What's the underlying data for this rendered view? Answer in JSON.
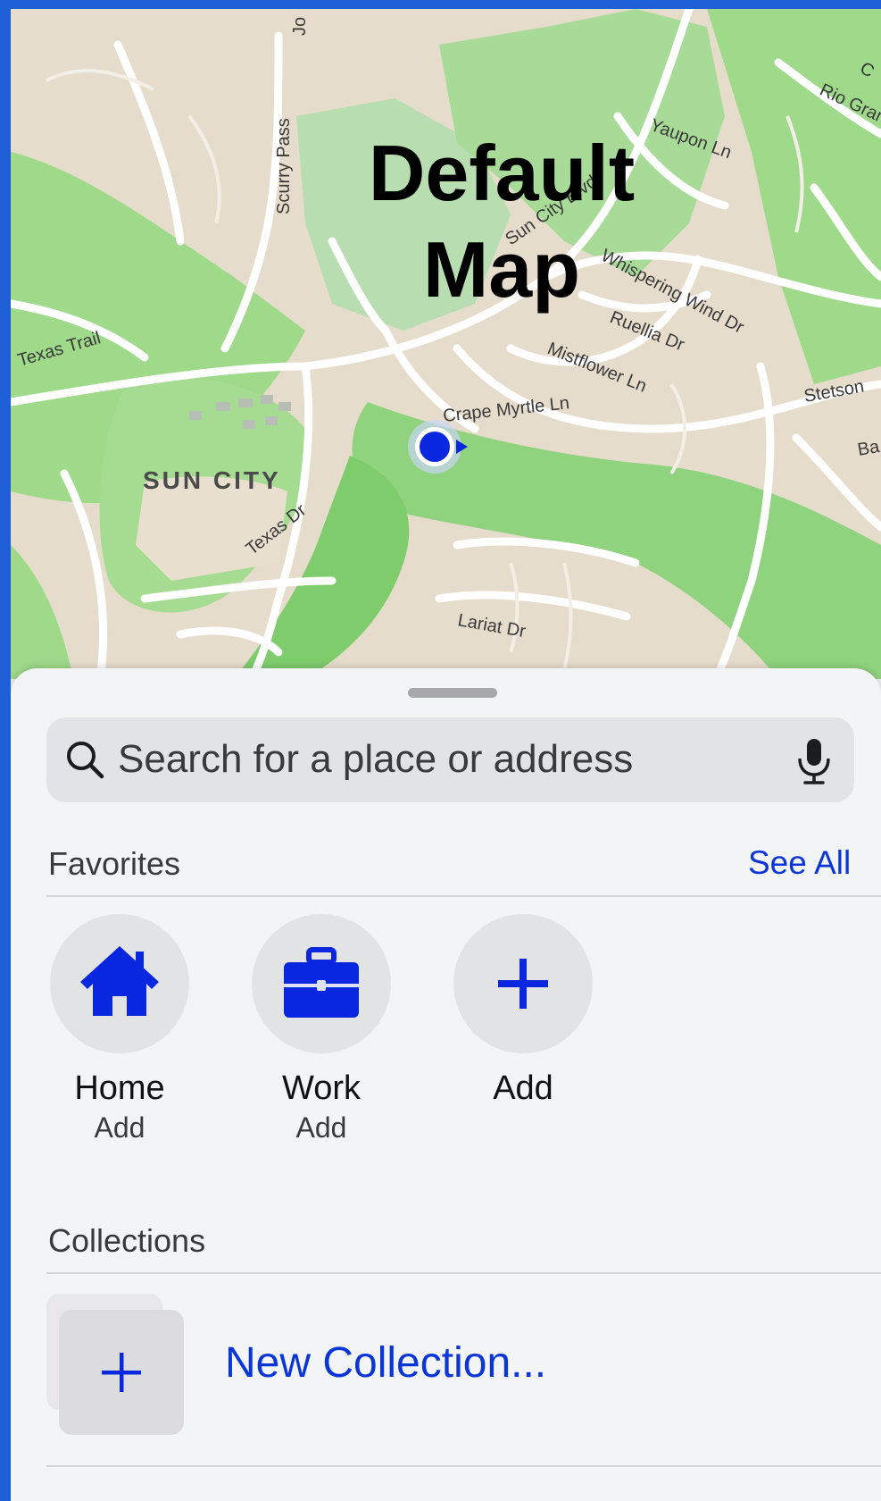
{
  "overlay": {
    "line1": "Default",
    "line2": "Map"
  },
  "map": {
    "labels": {
      "scurry_pass": "Scurry Pass",
      "yaupon_ln": "Yaupon Ln",
      "rio_grande": "Rio Gran",
      "sun_city_blvd": "Sun City Blvd",
      "whispering_wind": "Whispering Wind Dr",
      "ruellia": "Ruellia Dr",
      "mistflower": "Mistflower Ln",
      "texas_trail": "Texas Trail",
      "crepe_myrtle": "Crape Myrtle Ln",
      "stetson": "Stetson",
      "sun_city": "SUN CITY",
      "texas_dr": "Texas Dr",
      "lariat": "Lariat Dr",
      "ba": "Ba",
      "jo": "Jo",
      "co": "C"
    },
    "colors": {
      "land": "#e6dccb",
      "park": "#9fd98a",
      "park_dark": "#6cc460",
      "road": "#ffffff",
      "location": "#0a27e0"
    }
  },
  "search": {
    "placeholder": "Search for a place or address",
    "icon": "magnifying-glass",
    "mic_icon": "microphone"
  },
  "favorites": {
    "title": "Favorites",
    "see_all": "See All",
    "items": [
      {
        "name": "Home",
        "sub": "Add",
        "icon": "house"
      },
      {
        "name": "Work",
        "sub": "Add",
        "icon": "briefcase"
      },
      {
        "name": "Add",
        "sub": "",
        "icon": "plus"
      }
    ]
  },
  "collections": {
    "title": "Collections",
    "new_label": "New Collection..."
  },
  "accent_color": "#0a36d8"
}
